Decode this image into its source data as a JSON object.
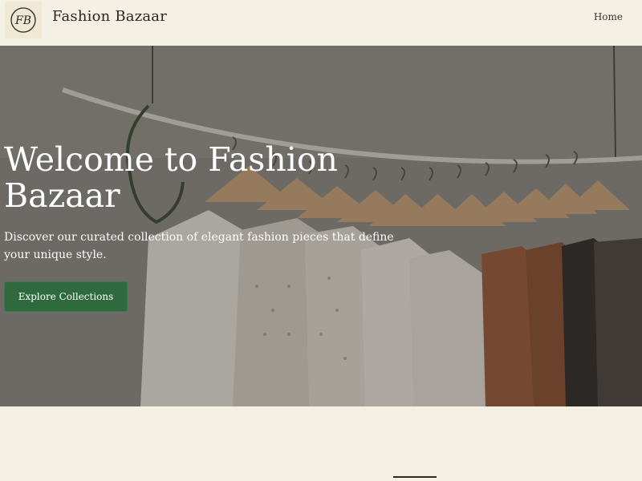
{
  "header": {
    "logo_icon": "fb-monogram-icon",
    "brand": "Fashion Bazaar",
    "nav": {
      "home": "Home"
    }
  },
  "hero": {
    "title": "Welcome to Fashion Bazaar",
    "subtitle": "Discover our curated collection of elegant fashion pieces that define your unique style.",
    "cta_label": "Explore Collections"
  },
  "colors": {
    "background": "#f4f0e3",
    "accent": "#2f6a3f",
    "text": "#2a2622"
  }
}
